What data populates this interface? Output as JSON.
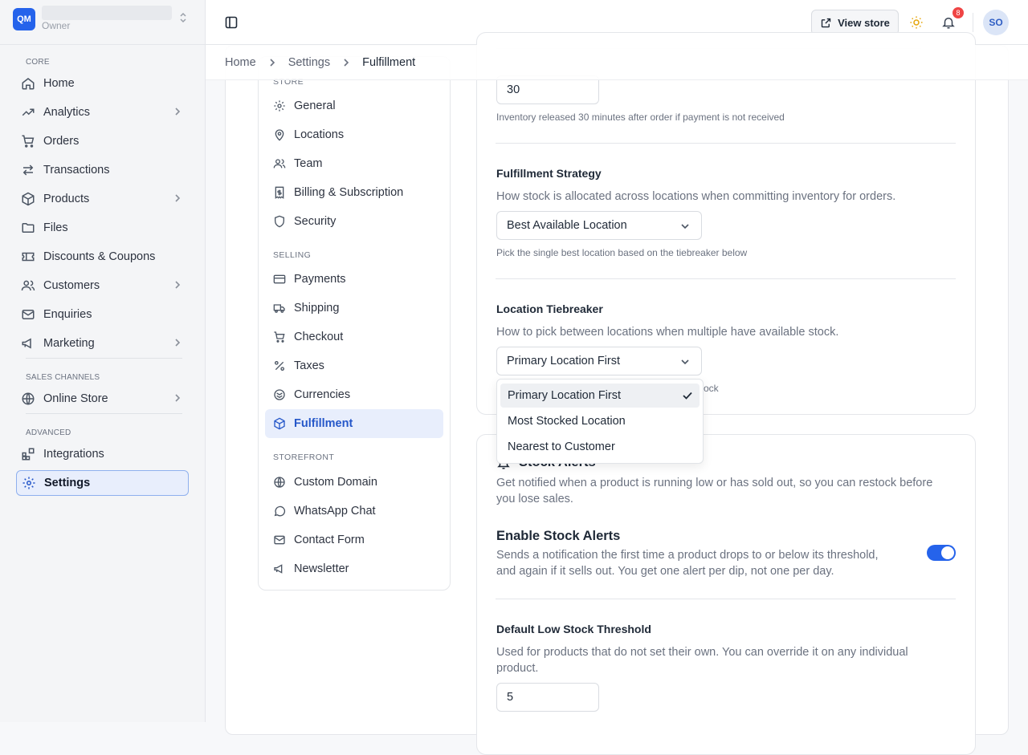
{
  "store": {
    "initials": "QM",
    "role": "Owner"
  },
  "sidebar": {
    "sections": {
      "core": "CORE",
      "sales_channels": "SALES CHANNELS",
      "advanced": "ADVANCED"
    },
    "items": [
      {
        "label": "Home",
        "icon": "home-icon"
      },
      {
        "label": "Analytics",
        "icon": "trending-up-icon"
      },
      {
        "label": "Orders",
        "icon": "cart-icon"
      },
      {
        "label": "Transactions",
        "icon": "arrows-exchange-icon"
      },
      {
        "label": "Products",
        "icon": "box-icon"
      },
      {
        "label": "Files",
        "icon": "folder-icon"
      },
      {
        "label": "Discounts & Coupons",
        "icon": "ticket-icon"
      },
      {
        "label": "Customers",
        "icon": "users-icon"
      },
      {
        "label": "Enquiries",
        "icon": "mail-icon"
      },
      {
        "label": "Marketing",
        "icon": "megaphone-icon"
      },
      {
        "label": "Online Store",
        "icon": "globe-icon"
      },
      {
        "label": "Integrations",
        "icon": "blocks-icon"
      },
      {
        "label": "Settings",
        "icon": "gear-icon"
      }
    ]
  },
  "topbar": {
    "view_store": "View store",
    "notification_count": "8",
    "avatar": "SO"
  },
  "breadcrumb": {
    "home": "Home",
    "settings": "Settings",
    "current": "Fulfillment"
  },
  "subnav": {
    "sections": {
      "store": "STORE",
      "selling": "SELLING",
      "storefront": "STOREFRONT"
    },
    "items": [
      {
        "label": "General",
        "icon": "gear-icon"
      },
      {
        "label": "Locations",
        "icon": "map-pin-icon"
      },
      {
        "label": "Team",
        "icon": "users-icon"
      },
      {
        "label": "Billing & Subscription",
        "icon": "receipt-icon"
      },
      {
        "label": "Security",
        "icon": "shield-icon"
      },
      {
        "label": "Payments",
        "icon": "credit-card-icon"
      },
      {
        "label": "Shipping",
        "icon": "truck-icon"
      },
      {
        "label": "Checkout",
        "icon": "cart-icon"
      },
      {
        "label": "Taxes",
        "icon": "percent-icon"
      },
      {
        "label": "Currencies",
        "icon": "coins-icon"
      },
      {
        "label": "Fulfillment",
        "icon": "box-icon"
      },
      {
        "label": "Custom Domain",
        "icon": "globe-icon"
      },
      {
        "label": "WhatsApp Chat",
        "icon": "message-circle-icon"
      },
      {
        "label": "Contact Form",
        "icon": "mail-icon"
      },
      {
        "label": "Newsletter",
        "icon": "megaphone-icon"
      }
    ]
  },
  "fulfillment": {
    "reservation_value": "30",
    "reservation_hint": "Inventory released 30 minutes after order if payment is not received",
    "strategy_label": "Fulfillment Strategy",
    "strategy_desc": "How stock is allocated across locations when committing inventory for orders.",
    "strategy_value": "Best Available Location",
    "strategy_hint": "Pick the single best location based on the tiebreaker below",
    "tiebreaker_label": "Location Tiebreaker",
    "tiebreaker_desc": "How to pick between locations when multiple have available stock.",
    "tiebreaker_value": "Primary Location First",
    "tiebreaker_hint_tail": "ock",
    "tiebreaker_options": [
      "Primary Location First",
      "Most Stocked Location",
      "Nearest to Customer"
    ]
  },
  "stock_alerts": {
    "title": "Stock Alerts",
    "desc_line1": "Get notified when a product is running low or has sold out, so you can restock before",
    "desc_line2": "you lose sales.",
    "enable_label": "Enable Stock Alerts",
    "enable_desc_line1": "Sends a notification the first time a product drops to or below its threshold,",
    "enable_desc_line2": "and again if it sells out. You get one alert per dip, not one per day.",
    "enabled": true,
    "threshold_label": "Default Low Stock Threshold",
    "threshold_desc_line1": "Used for products that do not set their own. You can override it on any individual",
    "threshold_desc_line2": "product.",
    "threshold_value": "5"
  },
  "colors": {
    "accent": "#2563eb",
    "badge": "#ef4444"
  }
}
